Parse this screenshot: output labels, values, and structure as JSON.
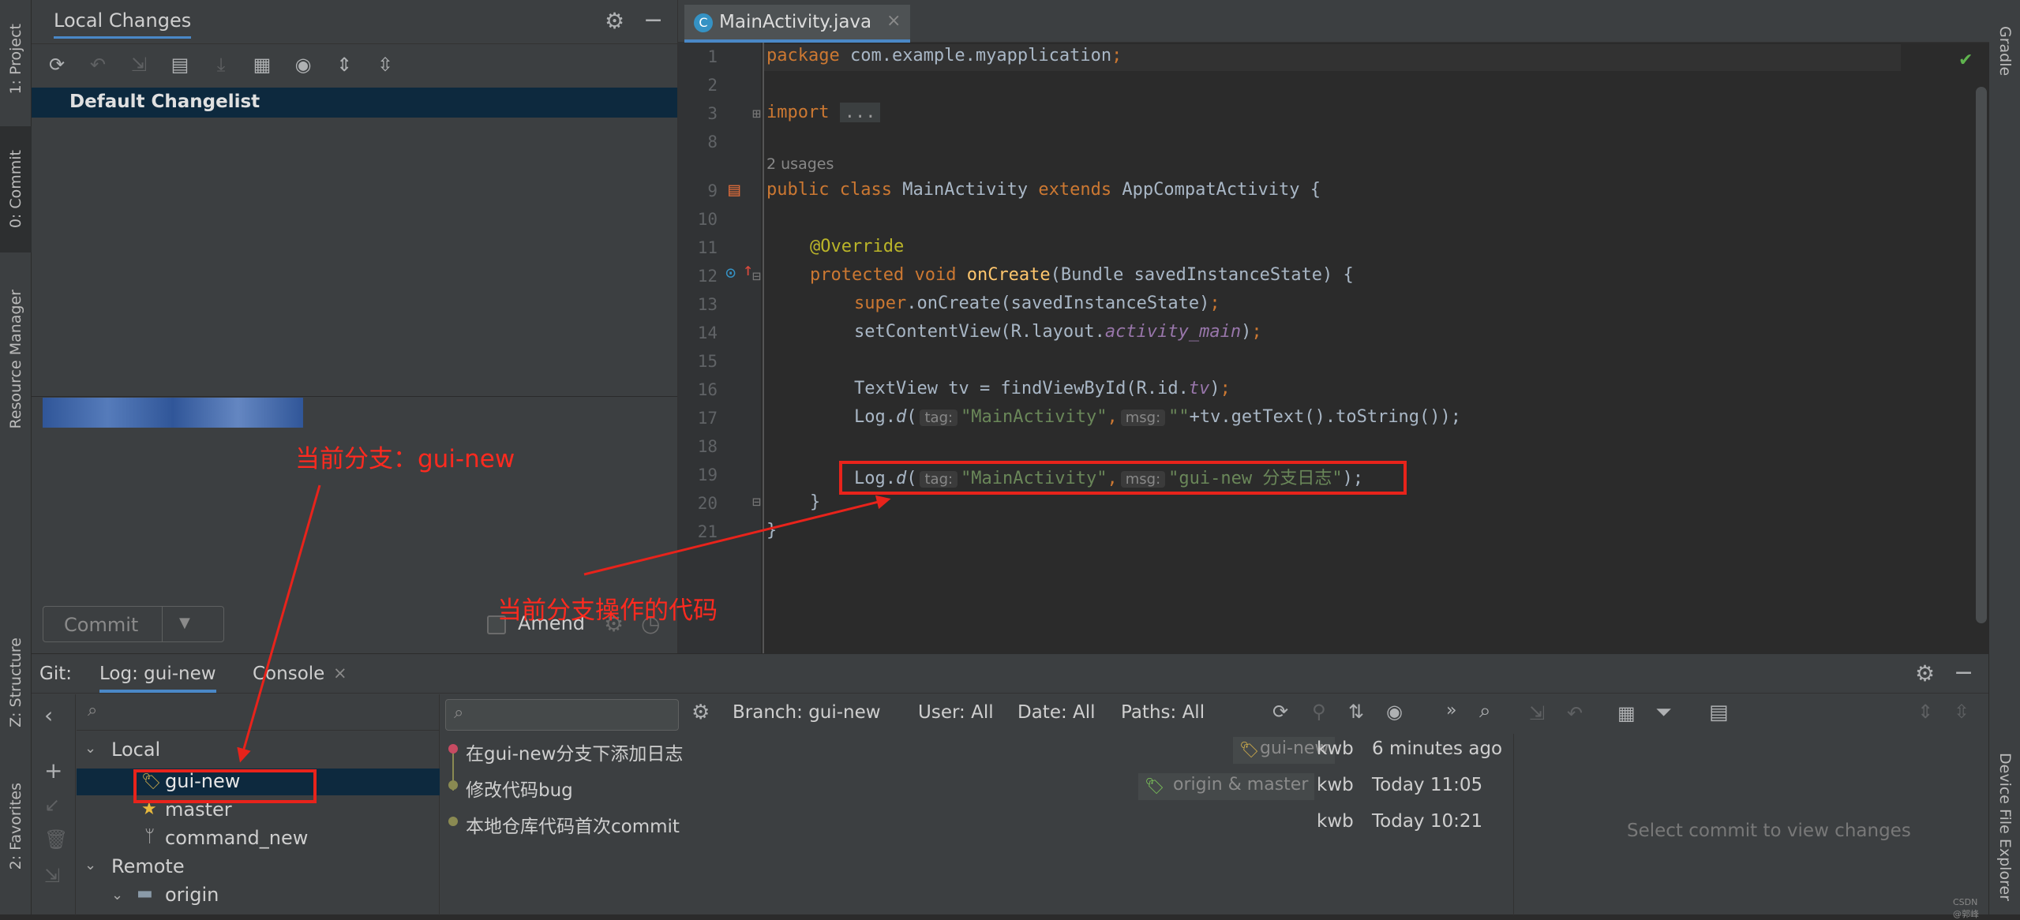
{
  "left_strip": {
    "project": "1: Project",
    "commit": "0: Commit",
    "resource_manager": "Resource Manager",
    "structure": "Z: Structure",
    "favorites": "2: Favorites"
  },
  "right_strip": {
    "gradle": "Gradle",
    "device_file_explorer": "Device File Explorer"
  },
  "commit_panel": {
    "title": "Local Changes",
    "changelist": "Default Changelist",
    "commit_button": "Commit",
    "amend_label": "Amend"
  },
  "editor": {
    "tab_label": "MainActivity.java",
    "tab_icon_letter": "C",
    "usages": "2 usages",
    "line_numbers": [
      "1",
      "2",
      "3",
      "8",
      "9",
      "10",
      "11",
      "12",
      "13",
      "14",
      "15",
      "16",
      "17",
      "18",
      "19",
      "20",
      "21"
    ],
    "lines": {
      "l1a": "package",
      " l1b": "",
      "pkg": " com.example.myapplication",
      "imp": "import",
      "dots": "...",
      "public": "public",
      "class": "class",
      "mainactivity": " MainActivity ",
      "extends": "extends",
      "appcompat": " AppCompatActivity {",
      "override": "@Override",
      "protected": "protected",
      "void": "void",
      "oncreate": "onCreate",
      "params": "(Bundle savedInstanceState) {",
      "super": "super",
      ".oncreate": ".onCreate(savedInstanceState)",
      "setcontent": "setContentView(R.layout.",
      "activity_main": "activity_main",
      ")": ")",
      "textview": "TextView tv = findViewById(R.id.",
      "tv": "tv",
      "logd": "Log.",
      "d": "d",
      "(": "(",
      "tag": "tag:",
      "tagval": "\"MainActivity\"",
      "msg": "msg:",
      "msgval17": "\"\"",
      "rest17": "+tv.getText().toString());",
      "msgval19": "\"gui-new 分支日志\"",
      "rest19": ");",
      "close1": "}",
      "close2": "}"
    }
  },
  "annotations": {
    "current_branch": "当前分支：gui-new",
    "current_code": "当前分支操作的代码"
  },
  "git_panel": {
    "git_label": "Git:",
    "tabs": [
      "Log: gui-new",
      "Console"
    ],
    "tree": {
      "local": "Local",
      "branches": [
        "gui-new",
        "master",
        "command_new"
      ],
      "remote": "Remote",
      "origin": "origin"
    },
    "filters": {
      "branch": "Branch: gui-new",
      "user": "User: All",
      "date": "Date: All",
      "paths": "Paths: All"
    },
    "commits": [
      {
        "message": "在gui-new分支下添加日志",
        "tag": "gui-new",
        "author": "kwb",
        "time": "6 minutes ago"
      },
      {
        "message": "修改代码bug",
        "tag": "origin & master",
        "author": "kwb",
        "time": "Today 11:05"
      },
      {
        "message": "本地仓库代码首次commit",
        "tag": "",
        "author": "kwb",
        "time": "Today 10:21"
      }
    ],
    "empty_details": "Select commit to view changes",
    "watermark": "CSDN @郭峰"
  },
  "colors": {
    "background": "#2b2b2b",
    "panel": "#3c3f41",
    "selection": "#0d293e",
    "annotation_red": "#e8231b"
  }
}
